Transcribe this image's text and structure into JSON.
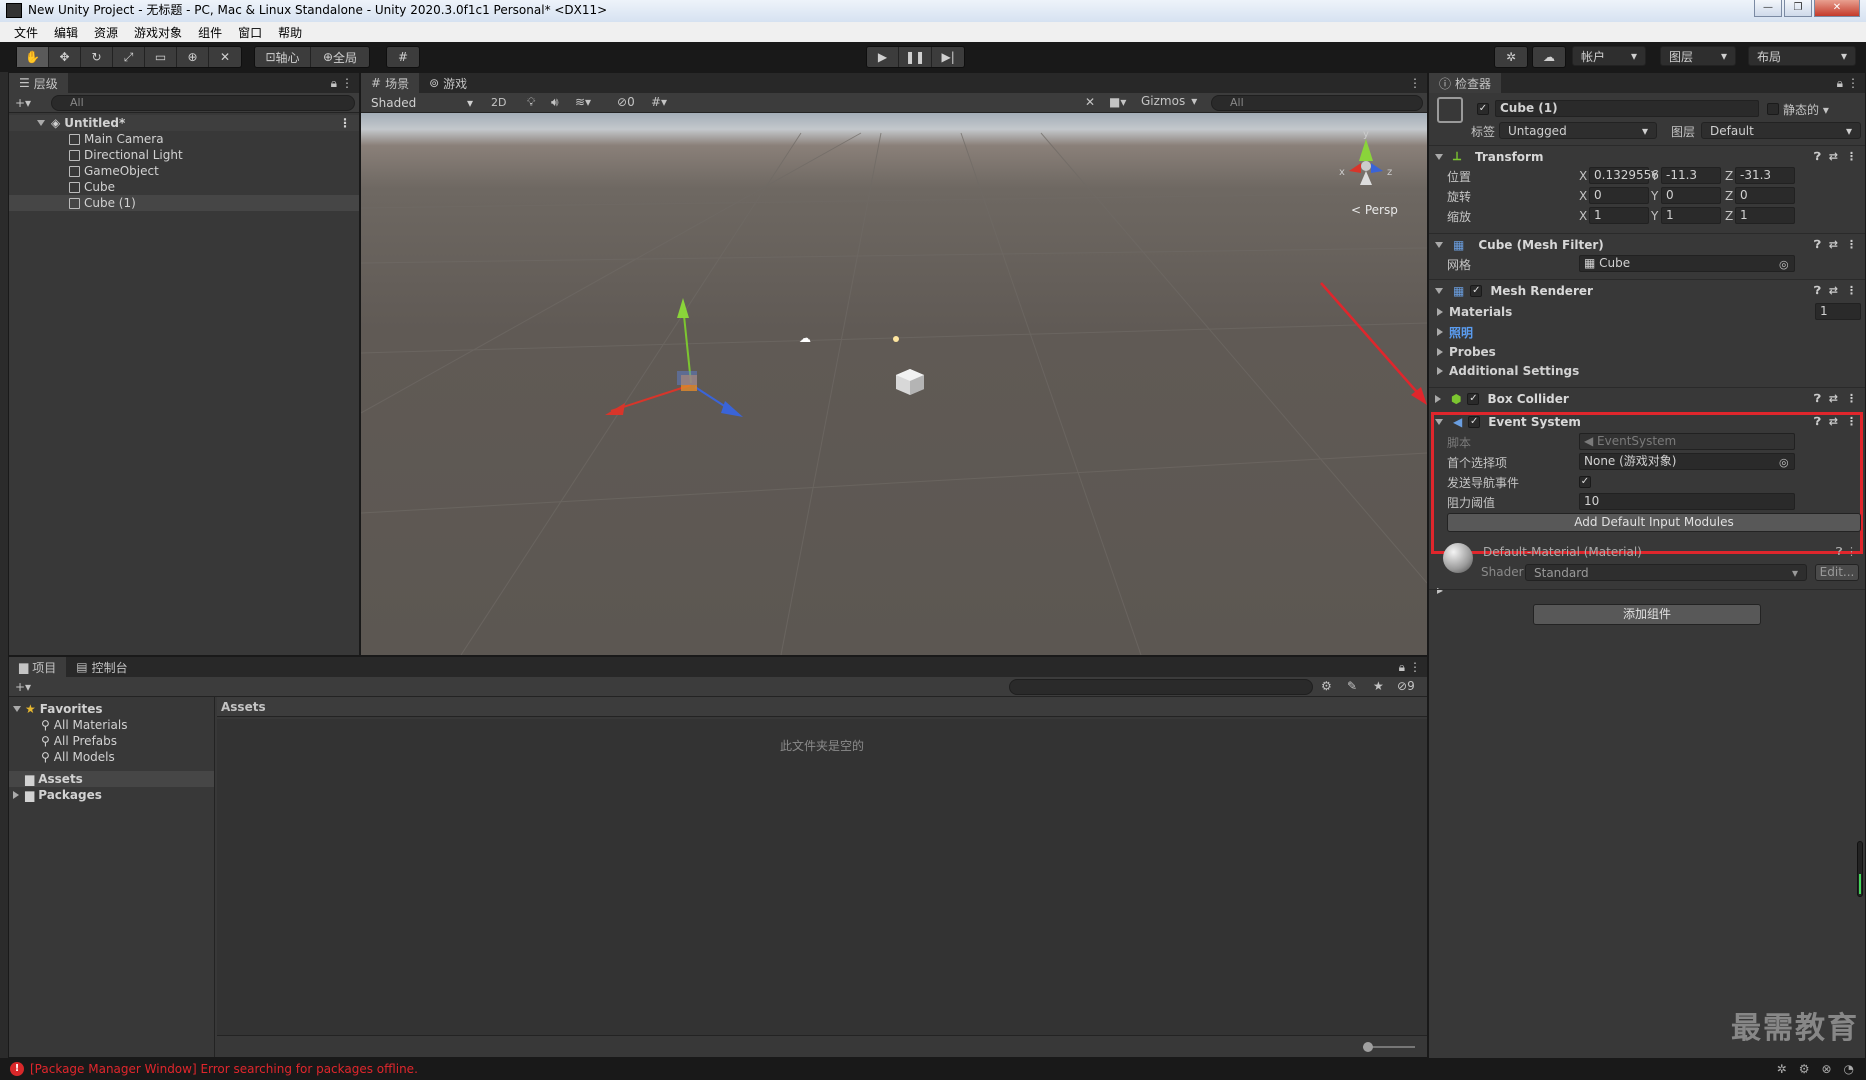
{
  "window": {
    "title": "New Unity Project - 无标题 - PC, Mac & Linux Standalone - Unity 2020.3.0f1c1 Personal* <DX11>",
    "min": "—",
    "max": "❐",
    "close": "✕"
  },
  "menu": [
    "文件",
    "编辑",
    "资源",
    "游戏对象",
    "组件",
    "窗口",
    "帮助"
  ],
  "toolbar": {
    "pivot": "轴心",
    "global": "全局",
    "account": "帐户",
    "layers": "图层",
    "layout": "布局"
  },
  "hierarchy": {
    "tab": "层级",
    "search": "All",
    "scene": "Untitled*",
    "items": [
      "Main Camera",
      "Directional Light",
      "GameObject",
      "Cube",
      "Cube (1)"
    ]
  },
  "scene_view": {
    "tab_scene": "场景",
    "tab_game": "游戏",
    "shading": "Shaded",
    "mode2d": "2D",
    "hidden_count": "0",
    "gizmos": "Gizmos",
    "search": "All",
    "persp": "< Persp",
    "axis_x": "x",
    "axis_y": "y",
    "axis_z": "z"
  },
  "inspector": {
    "tab": "检查器",
    "object_name": "Cube (1)",
    "static_label": "静态的",
    "tag_label": "标签",
    "tag_value": "Untagged",
    "layer_label": "图层",
    "layer_value": "Default",
    "transform": {
      "title": "Transform",
      "rows": [
        {
          "label": "位置",
          "x": "0.1329556",
          "y": "-11.3",
          "z": "-31.3"
        },
        {
          "label": "旋转",
          "x": "0",
          "y": "0",
          "z": "0"
        },
        {
          "label": "缩放",
          "x": "1",
          "y": "1",
          "z": "1"
        }
      ],
      "x": "X",
      "y": "Y",
      "z": "Z"
    },
    "mesh_filter": {
      "title": "Cube (Mesh Filter)",
      "mesh_label": "网格",
      "mesh_value": "Cube"
    },
    "mesh_renderer": {
      "title": "Mesh Renderer",
      "materials": "Materials",
      "materials_count": "1",
      "lighting": "照明",
      "probes": "Probes",
      "additional": "Additional Settings"
    },
    "box_collider": {
      "title": "Box Collider"
    },
    "event_system": {
      "title": "Event System",
      "script_label": "脚本",
      "script_value": "EventSystem",
      "first_selected_label": "首个选择项",
      "first_selected_value": "None (游戏对象)",
      "send_nav_label": "发送导航事件",
      "drag_label": "阻力阈值",
      "drag_value": "10",
      "add_modules": "Add Default Input Modules"
    },
    "material": {
      "name": "Default-Material (Material)",
      "shader_label": "Shader",
      "shader_value": "Standard",
      "edit": "Edit..."
    },
    "add_component": "添加组件",
    "colors": {
      "highlight": "#e0262c"
    }
  },
  "project": {
    "tab_project": "项目",
    "tab_console": "控制台",
    "favorites": "Favorites",
    "fav_items": [
      "All Materials",
      "All Prefabs",
      "All Models"
    ],
    "assets": "Assets",
    "packages": "Packages",
    "assets_header": "Assets",
    "empty_msg": "此文件夹是空的",
    "hidden_count": "9"
  },
  "status": {
    "error": "[Package Manager Window] Error searching for packages offline."
  },
  "watermark": "最需教育"
}
